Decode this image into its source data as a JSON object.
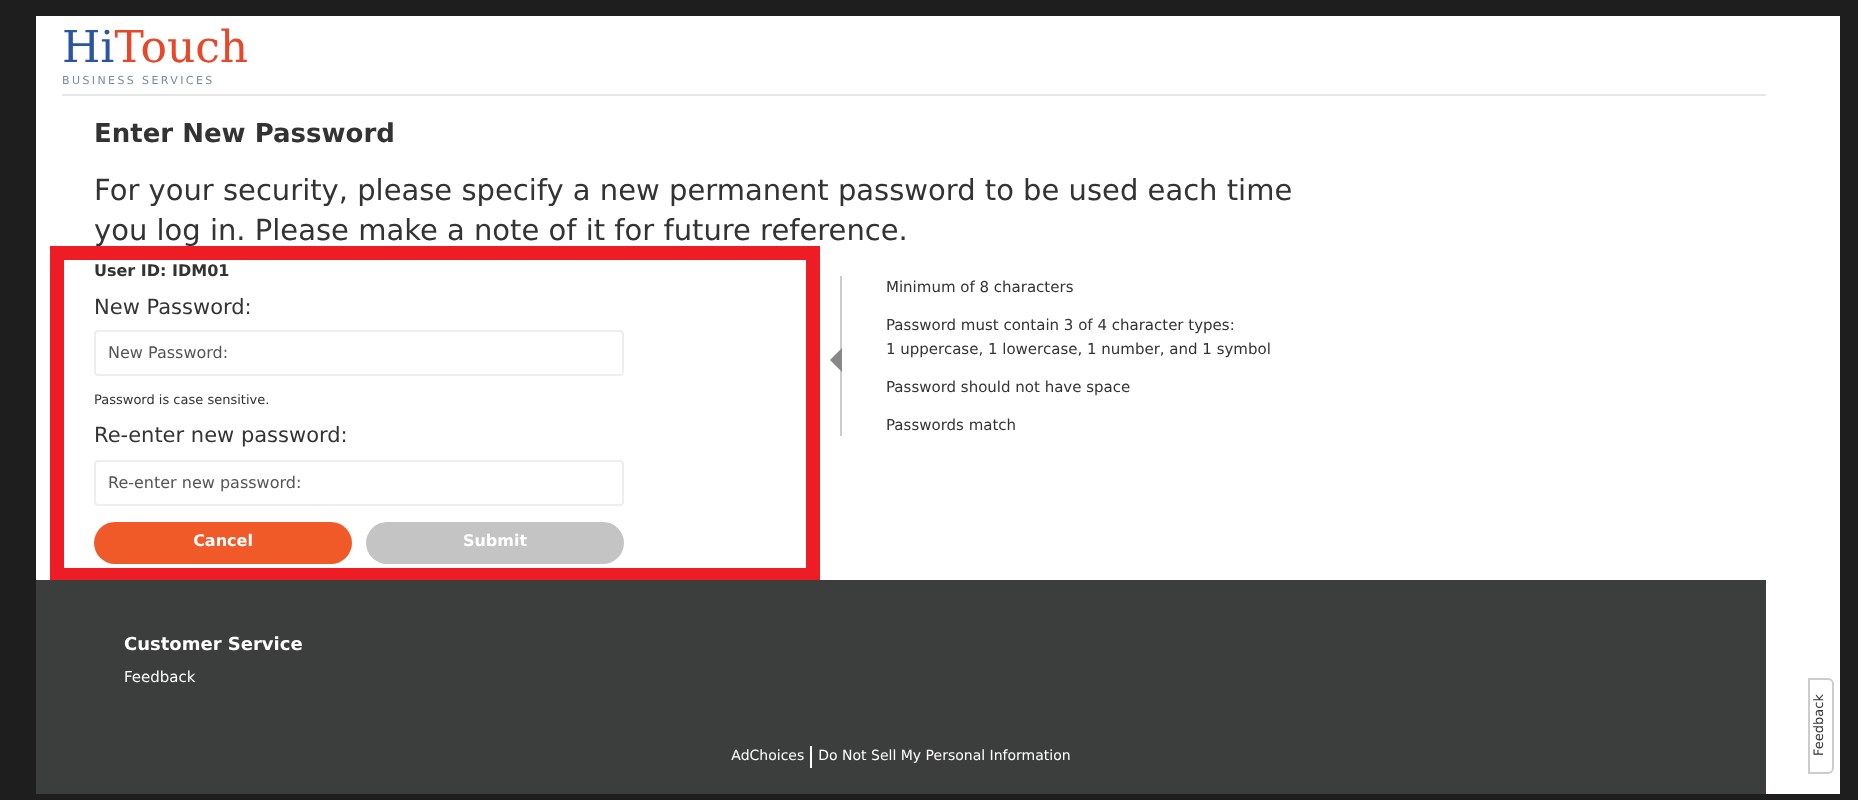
{
  "logo": {
    "first": "Hi",
    "second": "Touch",
    "tagline": "BUSINESS SERVICES"
  },
  "heading": "Enter New Password",
  "intro": "For your security, please specify a new permanent password to be used each time you log in. Please make a note of it for future reference.",
  "form": {
    "user_id": "User ID: IDM01",
    "highlighted": true,
    "fields": [
      {
        "label": "New Password:",
        "placeholder": "New Password:",
        "hint": "Password is case sensitive."
      },
      {
        "label": "Re-enter new password:",
        "placeholder": "Re-enter new password:"
      }
    ],
    "buttons": [
      {
        "label": "Cancel",
        "disabled": false
      },
      {
        "label": "Submit",
        "disabled": true
      }
    ]
  },
  "rules": [
    "Minimum of 8 characters",
    "Password must contain 3 of 4 character types:\n1 uppercase, 1 lowercase, 1 number, and 1 symbol",
    "Password should not have space",
    "Passwords match"
  ],
  "footer": {
    "section_title": "Customer Service",
    "links": [
      "Feedback"
    ],
    "bottom_links": [
      "AdChoices",
      "Do Not Sell My Personal Information"
    ]
  },
  "feedback_tab": "Feedback"
}
